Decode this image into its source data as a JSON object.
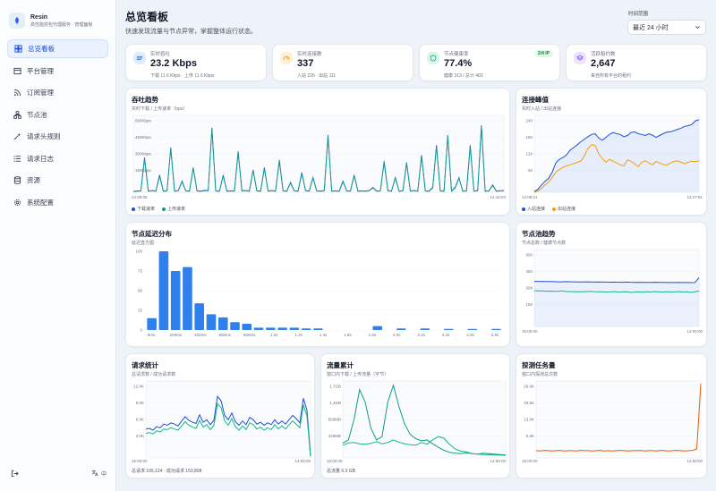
{
  "brand": {
    "name": "Resin",
    "subtitle": "高性能抓包代理服务 · 管理面板"
  },
  "nav": [
    {
      "label": "总览看板",
      "icon": "dashboard-icon",
      "active": true
    },
    {
      "label": "平台管理",
      "icon": "platform-icon"
    },
    {
      "label": "订阅管理",
      "icon": "rss-icon"
    },
    {
      "label": "节点池",
      "icon": "nodes-icon"
    },
    {
      "label": "请求头规则",
      "icon": "rules-icon"
    },
    {
      "label": "请求日志",
      "icon": "list-icon"
    },
    {
      "label": "资源",
      "icon": "database-icon"
    },
    {
      "label": "系统配置",
      "icon": "gear-icon"
    }
  ],
  "lang_label": "中",
  "header": {
    "title": "总览看板",
    "subtitle": "快速发现流量与节点异常，掌握整体运行状态。"
  },
  "range": {
    "label": "时间范围",
    "value": "最近 24 小时"
  },
  "stats": [
    {
      "label": "实时吞吐",
      "value": "23.2 Kbps",
      "sub": "下载 11.6 Kbps · 上传 11.6 Kbps",
      "icon": "throughput-icon",
      "color": "#3b82f6"
    },
    {
      "label": "实时连接数",
      "value": "337",
      "sub": "入站 226 · 出站 111",
      "icon": "gauge-icon",
      "color": "#f59e0b"
    },
    {
      "label": "节点健康率",
      "value": "77.4%",
      "sub": "健康 313 / 总计 403",
      "icon": "shield-icon",
      "color": "#10b981",
      "badge": "2/4 IP"
    },
    {
      "label": "活跃租约数",
      "value": "2,647",
      "sub": "来自所有平台的租约",
      "icon": "layers-icon",
      "color": "#8b5cf6"
    }
  ],
  "cards": {
    "throughput": {
      "title": "吞吐趋势",
      "subtitle": "实时下载 / 上传速率（bps）",
      "start": "14:08:06",
      "end": "14:18:04",
      "legend": [
        "下载速率",
        "上传速率"
      ]
    },
    "conn": {
      "title": "连接峰值",
      "subtitle": "实时入站 / 出站连接",
      "start": "14:08:21",
      "end": "14:17:51",
      "legend": [
        "入站连接",
        "出站连接"
      ]
    },
    "latency": {
      "title": "节点延迟分布",
      "subtitle": "延迟直方图"
    },
    "pool": {
      "title": "节点池趋势",
      "subtitle": "节点总数 / 健康节点数",
      "start": "15:00:00",
      "end": "14:00:00"
    },
    "requests": {
      "title": "请求统计",
      "subtitle": "总请求数 / 成功请求数",
      "start": "15:00:00",
      "end": "14:00:00",
      "footer": "总请求 195,124 · 成功请求 153,808"
    },
    "traffic": {
      "title": "流量累计",
      "subtitle": "窗口内下载 / 上传流量（字节）",
      "start": "15:00:00",
      "end": "14:00:00",
      "footer": "总流量 6.3 GB"
    },
    "probe": {
      "title": "探测任务量",
      "subtitle": "窗口内探测总次数",
      "start": "15:00:00",
      "end": "14:00:00"
    }
  },
  "chart_data": [
    {
      "type": "line",
      "title": "吞吐趋势",
      "yticks": [
        "600Kbps",
        "450Kbps",
        "300Kbps",
        "150Kbps"
      ],
      "ylim": [
        0,
        620
      ],
      "series": [
        {
          "name": "下载速率",
          "color": "#1d4ed8",
          "values": [
            8,
            10,
            12,
            280,
            10,
            14,
            10,
            140,
            10,
            12,
            360,
            10,
            14,
            90,
            12,
            10,
            200,
            12,
            10,
            16,
            14,
            520,
            12,
            10,
            140,
            10,
            12,
            10,
            330,
            12,
            14,
            10,
            180,
            12,
            10,
            200,
            10,
            14,
            10,
            260,
            12,
            10,
            80,
            12,
            10,
            160,
            14,
            10,
            120,
            12,
            10,
            14,
            460,
            10,
            12,
            10,
            90,
            12,
            10,
            140,
            10,
            12,
            10,
            14,
            40,
            10,
            12,
            250,
            14,
            10,
            120,
            10,
            12,
            240,
            10,
            14,
            10,
            300,
            12,
            10,
            40,
            380,
            12,
            10,
            460,
            10,
            40,
            120,
            10,
            12,
            380,
            10,
            14,
            540,
            10,
            12,
            60,
            10,
            12,
            14
          ]
        },
        {
          "name": "上传速率",
          "color": "#0f9d8a",
          "values": [
            6,
            8,
            10,
            270,
            8,
            12,
            8,
            130,
            8,
            10,
            350,
            8,
            12,
            85,
            10,
            8,
            195,
            10,
            8,
            12,
            12,
            510,
            10,
            8,
            135,
            8,
            10,
            8,
            320,
            10,
            12,
            8,
            175,
            10,
            8,
            190,
            8,
            12,
            8,
            250,
            10,
            8,
            75,
            10,
            8,
            150,
            12,
            8,
            115,
            10,
            8,
            12,
            450,
            8,
            10,
            8,
            85,
            10,
            8,
            135,
            8,
            10,
            8,
            12,
            35,
            8,
            10,
            240,
            12,
            8,
            115,
            8,
            10,
            230,
            8,
            12,
            8,
            290,
            10,
            8,
            35,
            370,
            10,
            8,
            450,
            8,
            35,
            115,
            8,
            10,
            370,
            8,
            12,
            530,
            8,
            10,
            55,
            8,
            10,
            12
          ]
        }
      ]
    },
    {
      "type": "area",
      "title": "连接峰值",
      "yticks": [
        "240",
        "180",
        "120",
        "60"
      ],
      "ylim": [
        40,
        250
      ],
      "series": [
        {
          "name": "入站连接",
          "color": "#1d4ed8",
          "values": [
            42,
            48,
            60,
            70,
            78,
            95,
            120,
            130,
            135,
            142,
            155,
            162,
            170,
            178,
            185,
            192,
            198,
            200,
            188,
            182,
            190,
            198,
            203,
            200,
            198,
            192,
            195,
            203,
            205,
            200,
            198,
            195,
            200,
            196,
            190,
            195,
            200,
            204,
            205,
            208,
            212,
            215,
            220,
            222,
            225,
            235,
            238
          ]
        },
        {
          "name": "出站连接",
          "color": "#f59e0b",
          "values": [
            40,
            44,
            50,
            60,
            68,
            80,
            95,
            102,
            108,
            112,
            115,
            118,
            122,
            125,
            140,
            160,
            170,
            168,
            145,
            132,
            122,
            130,
            125,
            120,
            115,
            112,
            128,
            125,
            118,
            110,
            122,
            126,
            120,
            115,
            124,
            120,
            116,
            114,
            120,
            124,
            126,
            122,
            118,
            122,
            125,
            124,
            126
          ]
        }
      ]
    },
    {
      "type": "bar",
      "title": "节点延迟分布",
      "categories": [
        "0ms",
        "100ms",
        "200ms",
        "300ms",
        "400ms",
        "500ms",
        "600ms",
        "700ms",
        "800ms",
        "900ms",
        "1.0s",
        "1.1s",
        "1.2s",
        "1.3s",
        "1.4s",
        "1.5s",
        "1.6s",
        "1.7s",
        "1.8s",
        "1.9s",
        "2.0s",
        "2.1s",
        "2.2s",
        "2.3s",
        "2.4s",
        "2.5s",
        "2.6s",
        "2.7s",
        "2.8s",
        "2.9s",
        "3s"
      ],
      "xticks": [
        "0ms",
        "200ms",
        "400ms",
        "600ms",
        "800ms",
        "1.0s",
        "1.2s",
        "1.4s",
        "1.6s",
        "1.8s",
        "2.0s",
        "2.2s",
        "2.4s",
        "2.6s",
        "2.9s"
      ],
      "yticks": [
        "100",
        "75",
        "50",
        "25",
        "0"
      ],
      "ylim": [
        0,
        100
      ],
      "values": [
        15,
        100,
        75,
        80,
        34,
        20,
        16,
        10,
        8,
        3,
        3,
        3,
        3,
        2,
        2,
        0,
        0,
        0,
        0,
        5,
        0,
        2,
        0,
        2,
        0,
        1,
        0,
        1,
        0,
        1
      ]
    },
    {
      "type": "line",
      "title": "节点池趋势",
      "yticks": [
        "600",
        "450",
        "300",
        "150"
      ],
      "ylim": [
        100,
        620
      ],
      "series": [
        {
          "name": "节点总数",
          "color": "#1d4ed8",
          "values": [
            405,
            405,
            404,
            404,
            403,
            403,
            402,
            402,
            403,
            402,
            402,
            401,
            401,
            402,
            401,
            400,
            401,
            400,
            400,
            399,
            400,
            399,
            399,
            400,
            399,
            398,
            399,
            398,
            398,
            398,
            399,
            398,
            398,
            397,
            397,
            397,
            398,
            397,
            397,
            396,
            397,
            430
          ]
        },
        {
          "name": "健康节点数",
          "color": "#10b981",
          "values": [
            342,
            340,
            340,
            338,
            339,
            337,
            338,
            340,
            336,
            335,
            335,
            334,
            335,
            336,
            337,
            335,
            334,
            334,
            333,
            334,
            336,
            332,
            334,
            335,
            330,
            333,
            334,
            332,
            335,
            333,
            336,
            334,
            332,
            335,
            333,
            334,
            336,
            333,
            334,
            330,
            334,
            340
          ]
        }
      ]
    },
    {
      "type": "line",
      "title": "请求统计",
      "yticks": [
        "12.0K",
        "9.0K",
        "6.0K",
        "3.0K"
      ],
      "ylim": [
        500,
        13000
      ],
      "series": [
        {
          "name": "总请求",
          "color": "#1d4ed8",
          "values": [
            5200,
            5300,
            5000,
            5600,
            5400,
            6000,
            5800,
            6200,
            6000,
            5700,
            6500,
            7200,
            6600,
            6300,
            6100,
            7500,
            6300,
            6700,
            5900,
            6600,
            10500,
            9800,
            7400,
            6700,
            7800,
            6400,
            5800,
            6500,
            5900,
            7100,
            6700,
            6000,
            6300,
            5800,
            6200,
            5900,
            6700,
            6000,
            6500,
            6000,
            6700,
            7400,
            6900,
            6200,
            10200,
            8200,
            800
          ]
        },
        {
          "name": "成功请求",
          "color": "#10b981",
          "values": [
            4500,
            4600,
            4400,
            4900,
            4700,
            5200,
            5100,
            5400,
            5200,
            5000,
            5700,
            6400,
            5800,
            5500,
            5300,
            6600,
            5500,
            5900,
            5100,
            5800,
            9300,
            8700,
            6500,
            5800,
            6900,
            5600,
            5000,
            5700,
            5100,
            6200,
            5900,
            5200,
            5500,
            5000,
            5400,
            5100,
            5900,
            5200,
            5700,
            5200,
            5900,
            6500,
            6000,
            5400,
            9100,
            7300,
            700
          ]
        }
      ]
    },
    {
      "type": "line",
      "title": "流量累计",
      "yticks": [
        "1.7GB",
        "1.3GB",
        "858MB",
        "429MB"
      ],
      "ylim": [
        0,
        1800000000
      ],
      "series": [
        {
          "name": "下载",
          "color": "#0f9d8a",
          "values": [
            350000000,
            420000000,
            900000000,
            1600000000,
            1300000000,
            700000000,
            420000000,
            500000000,
            1300000000,
            1700000000,
            1200000000,
            800000000,
            550000000,
            450000000,
            400000000,
            420000000,
            330000000,
            250000000,
            180000000,
            130000000,
            110000000,
            100000000,
            120000000,
            100000000,
            90000000,
            110000000,
            100000000,
            90000000,
            80000000,
            70000000
          ]
        },
        {
          "name": "上传",
          "color": "#10b981",
          "values": [
            300000000,
            350000000,
            360000000,
            330000000,
            320000000,
            340000000,
            380000000,
            330000000,
            360000000,
            420000000,
            370000000,
            330000000,
            310000000,
            300000000,
            360000000,
            320000000,
            420000000,
            500000000,
            460000000,
            320000000,
            210000000,
            160000000,
            140000000,
            100000000,
            90000000,
            80000000,
            75000000,
            70000000,
            65000000,
            60000000
          ]
        }
      ]
    },
    {
      "type": "line",
      "title": "探测任务量",
      "yticks": [
        "26.0K",
        "19.5K",
        "13.0K",
        "6.5K"
      ],
      "ylim": [
        0,
        27500
      ],
      "series": [
        {
          "name": "探测总次数",
          "color": "#ea580c",
          "values": [
            2600,
            2500,
            2700,
            2600,
            2500,
            2600,
            2700,
            2500,
            2600,
            2600,
            2500,
            2700,
            2600,
            2600,
            2500,
            2600,
            2700,
            2500,
            2600,
            2500,
            2600,
            2700,
            2600,
            2500,
            2600,
            2600,
            2700,
            2500,
            2600,
            2600,
            2500,
            2700,
            2600,
            2500,
            2600,
            2700,
            2600,
            2500,
            2600,
            2700,
            3200,
            26500
          ]
        }
      ]
    }
  ]
}
